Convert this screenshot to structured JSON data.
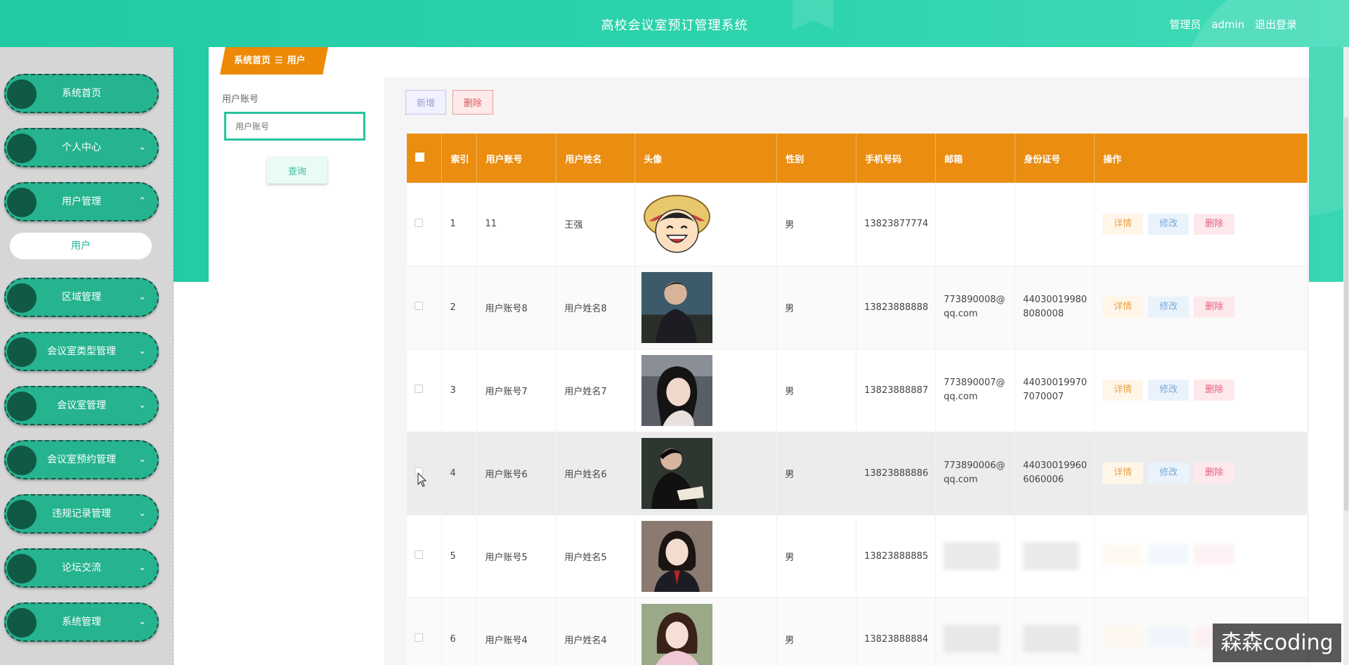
{
  "header": {
    "title": "高校会议室预订管理系统",
    "user_role": "管理员",
    "username": "admin",
    "logout": "退出登录"
  },
  "sidebar": {
    "items": [
      {
        "label": "系统首页",
        "chevron": ""
      },
      {
        "label": "个人中心",
        "chevron": "⌄"
      },
      {
        "label": "用户管理",
        "chevron": "⌃"
      },
      {
        "label": "区域管理",
        "chevron": "⌄"
      },
      {
        "label": "会议室类型管理",
        "chevron": "⌄"
      },
      {
        "label": "会议室管理",
        "chevron": "⌄"
      },
      {
        "label": "会议室预约管理",
        "chevron": "⌄"
      },
      {
        "label": "违规记录管理",
        "chevron": "⌄"
      },
      {
        "label": "论坛交流",
        "chevron": "⌄"
      },
      {
        "label": "系统管理",
        "chevron": "⌄"
      }
    ],
    "subitem": "用户"
  },
  "breadcrumb": {
    "home": "系统首页",
    "separator": "☰",
    "current": "用户"
  },
  "search": {
    "label": "用户账号",
    "placeholder": "用户账号",
    "button": "查询"
  },
  "toolbar": {
    "add": "新增",
    "delete": "删除"
  },
  "table": {
    "columns": [
      "索引",
      "用户账号",
      "用户姓名",
      "头像",
      "性别",
      "手机号码",
      "邮箱",
      "身份证号",
      "操作"
    ],
    "ops": {
      "detail": "详情",
      "edit": "修改",
      "delete": "删除"
    },
    "rows": [
      {
        "index": "1",
        "account": "11",
        "name": "王强",
        "gender": "男",
        "phone": "13823877774",
        "email": "",
        "idcard": "",
        "avatar": "cartoon-avatar"
      },
      {
        "index": "2",
        "account": "用户账号8",
        "name": "用户姓名8",
        "gender": "男",
        "phone": "13823888888",
        "email": "773890008@qq.com",
        "idcard": "440300199808080008",
        "avatar": "photo-avatar"
      },
      {
        "index": "3",
        "account": "用户账号7",
        "name": "用户姓名7",
        "gender": "男",
        "phone": "13823888887",
        "email": "773890007@qq.com",
        "idcard": "440300199707070007",
        "avatar": "photo-avatar"
      },
      {
        "index": "4",
        "account": "用户账号6",
        "name": "用户姓名6",
        "gender": "男",
        "phone": "13823888886",
        "email": "773890006@qq.com",
        "idcard": "440300199606060006",
        "avatar": "photo-avatar"
      },
      {
        "index": "5",
        "account": "用户账号5",
        "name": "用户姓名5",
        "gender": "男",
        "phone": "13823888885",
        "email": "",
        "idcard": "",
        "avatar": "photo-avatar"
      },
      {
        "index": "6",
        "account": "用户账号4",
        "name": "用户姓名4",
        "gender": "男",
        "phone": "13823888884",
        "email": "",
        "idcard": "",
        "avatar": "photo-avatar"
      }
    ]
  },
  "watermark": "森森coding",
  "colors": {
    "primary": "#22c9a3",
    "accent": "#ea8d10",
    "sidebar_item": "#25b390",
    "sidebar_dot": "#0f5945"
  }
}
